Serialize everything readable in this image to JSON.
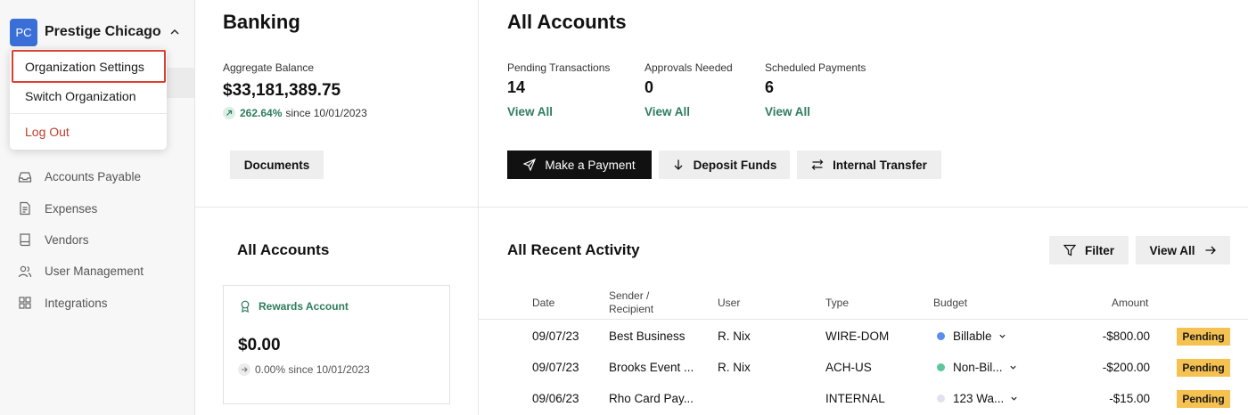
{
  "org": {
    "initials": "PC",
    "name": "Prestige Chicago"
  },
  "org_menu": {
    "settings": "Organization Settings",
    "switch": "Switch Organization",
    "logout": "Log Out"
  },
  "sidebar": {
    "items": [
      {
        "label": "Accounts Payable",
        "icon": "inbox-icon"
      },
      {
        "label": "Expenses",
        "icon": "receipt-icon"
      },
      {
        "label": "Vendors",
        "icon": "book-icon"
      },
      {
        "label": "User Management",
        "icon": "users-icon"
      },
      {
        "label": "Integrations",
        "icon": "grid-icon"
      }
    ]
  },
  "banking": {
    "title": "Banking",
    "aggregate_label": "Aggregate Balance",
    "aggregate_value": "$33,181,389.75",
    "growth_pct": "262.64%",
    "growth_since": "since 10/01/2023",
    "documents_label": "Documents"
  },
  "accounts_top": {
    "title": "All Accounts",
    "stats": [
      {
        "label": "Pending Transactions",
        "value": "14",
        "link": "View All"
      },
      {
        "label": "Approvals Needed",
        "value": "0",
        "link": "View All"
      },
      {
        "label": "Scheduled Payments",
        "value": "6",
        "link": "View All"
      }
    ],
    "actions": {
      "make_payment": "Make a Payment",
      "deposit": "Deposit Funds",
      "transfer": "Internal Transfer"
    }
  },
  "accounts_left": {
    "title": "All Accounts",
    "card": {
      "name": "Rewards Account",
      "balance": "$0.00",
      "growth": "0.00% since 10/01/2023"
    }
  },
  "activity": {
    "title": "All Recent Activity",
    "filter_label": "Filter",
    "view_all_label": "View All",
    "columns": {
      "date": "Date",
      "sender_1": "Sender /",
      "sender_2": "Recipient",
      "user": "User",
      "type": "Type",
      "budget": "Budget",
      "amount": "Amount"
    },
    "rows": [
      {
        "date": "09/07/23",
        "sender": "Best Business",
        "user": "R. Nix",
        "type": "WIRE-DOM",
        "budget": "Billable",
        "budget_color": "#5b8def",
        "amount": "-$800.00",
        "status": "Pending"
      },
      {
        "date": "09/07/23",
        "sender": "Brooks Event ...",
        "user": "R. Nix",
        "type": "ACH-US",
        "budget": "Non-Bil...",
        "budget_color": "#5cc79b",
        "amount": "-$200.00",
        "status": "Pending"
      },
      {
        "date": "09/06/23",
        "sender": "Rho Card Pay...",
        "user": "",
        "type": "INTERNAL",
        "budget": "123 Wa...",
        "budget_color": "#e3e1f0",
        "amount": "-$15.00",
        "status": "Pending"
      }
    ]
  },
  "colors": {
    "accent_green": "#2e7d5b",
    "badge_pending": "#f5c150",
    "avatar_blue": "#3b6fd8",
    "highlight_red": "#d9412f"
  }
}
